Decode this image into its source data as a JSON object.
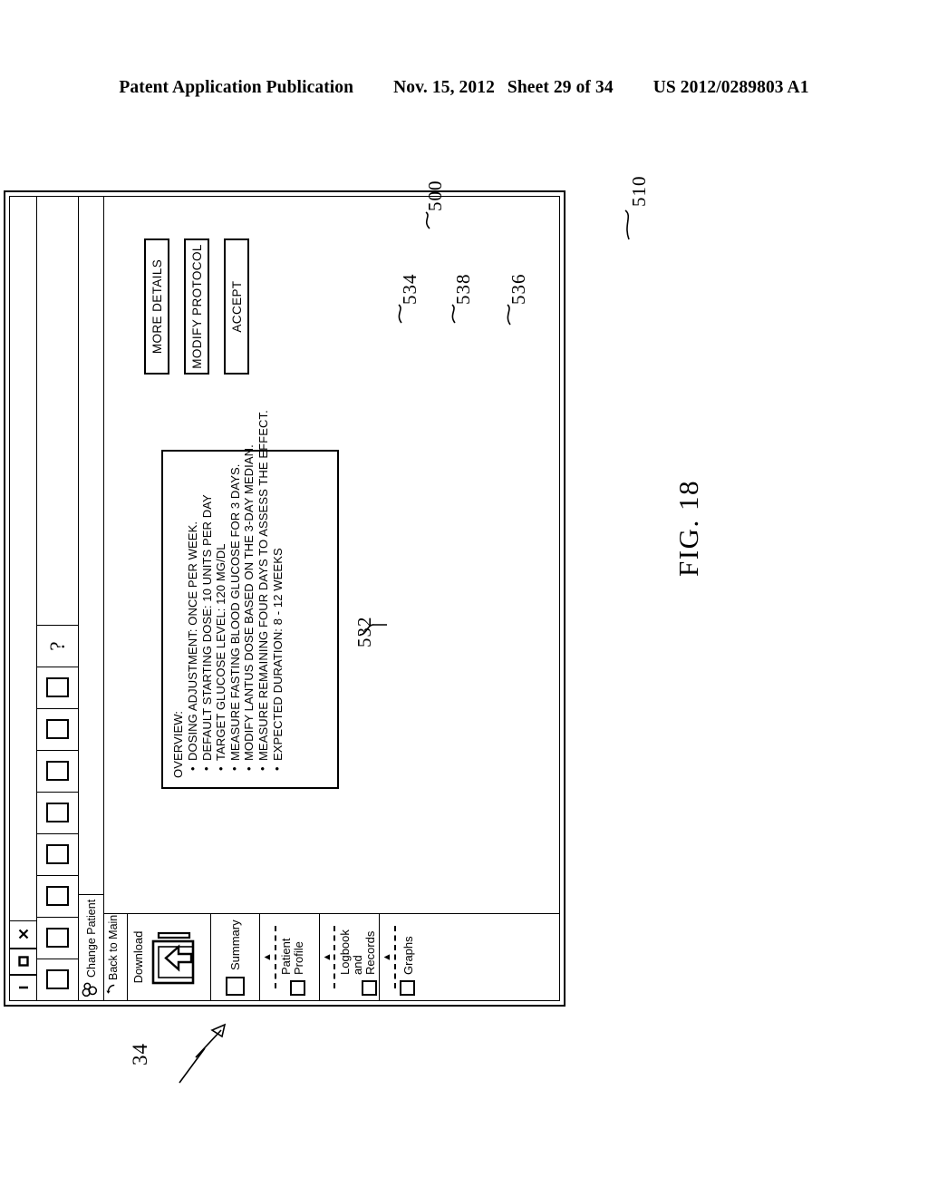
{
  "page_header": {
    "publication": "Patent Application Publication",
    "date": "Nov. 15, 2012",
    "sheet": "Sheet 29 of 34",
    "patent_number": "US 2012/0289803 A1"
  },
  "figure": {
    "label": "FIG. 18",
    "system_ref": "34"
  },
  "window": {
    "controls": {
      "close_icon": "close-icon",
      "maximize_icon": "maximize-icon",
      "minimize_icon": "minimize-icon"
    },
    "toolbar": {
      "buttons": [
        "toolbar-button-1",
        "toolbar-button-2",
        "toolbar-button-3",
        "toolbar-button-4",
        "toolbar-button-5",
        "toolbar-button-6",
        "toolbar-button-7",
        "toolbar-button-8"
      ],
      "help_glyph": "?"
    },
    "change_patient": {
      "label": "Change Patient",
      "icon": "people-icon"
    },
    "sidebar": {
      "back_label": "Back to Main Menu",
      "download_label": "Download",
      "summary_label": "Summary",
      "tabs": [
        {
          "label": "Patient Profile",
          "expander": "▲"
        },
        {
          "label": "Logbook and Records",
          "expander": "▲"
        },
        {
          "label": "Graphs",
          "expander": "▲"
        }
      ]
    }
  },
  "overview": {
    "title": "OVERVIEW:",
    "items": [
      "DOSING ADJUSTMENT:    ONCE PER WEEK.",
      "DEFAULT STARTING DOSE: 10 UNITS PER DAY",
      "TARGET GLUCOSE LEVEL:  120 MG/DL",
      "MEASURE FASTING BLOOD GLUCOSE FOR 3 DAYS.",
      "MODIFY LANTUS DOSE BASED ON THE 3-DAY MEDIAN.",
      "MEASURE REMAINING FOUR DAYS TO ASSESS THE EFFECT.",
      "EXPECTED DURATION:  8 - 12 WEEKS"
    ]
  },
  "actions": [
    {
      "label": "MORE DETAILS",
      "ref": "534"
    },
    {
      "label": "MODIFY PROTOCOL",
      "ref": "538"
    },
    {
      "label": "ACCEPT",
      "ref": "536"
    }
  ],
  "references": {
    "window_ref": "500",
    "content_ref": "510",
    "overview_ref": "532"
  }
}
